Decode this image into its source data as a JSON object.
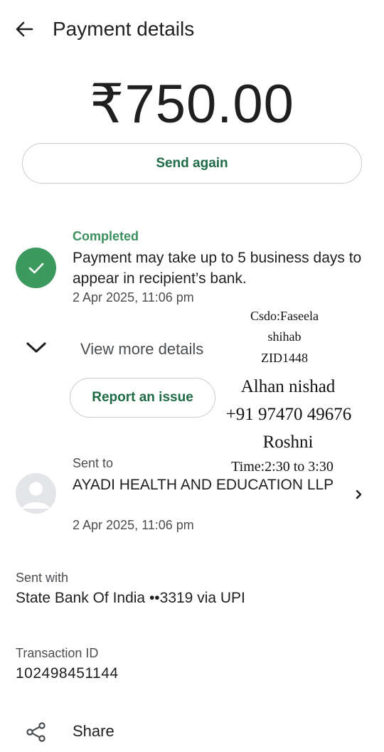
{
  "header": {
    "title": "Payment details",
    "back_icon": "arrow-left-icon"
  },
  "payment": {
    "amount": "₹750.00",
    "send_again_label": "Send again"
  },
  "status": {
    "label": "Completed",
    "message": "Payment may take up to 5 business days to appear in recipient’s bank.",
    "date": "2 Apr 2025, 11:06 pm",
    "icon": "check-circle-icon",
    "color": "#3d9a5e"
  },
  "details": {
    "view_more_label": "View more details",
    "report_label": "Report an issue"
  },
  "overlay_text": {
    "line1": "Csdo:Faseela",
    "line2": "shihab",
    "line3": "ZID1448",
    "line4": "Alhan nishad",
    "line5": "+91 97470 49676",
    "line6": "Roshni",
    "line7": "Time:2:30 to 3:30"
  },
  "recipient": {
    "label": "Sent to",
    "name": "AYADI HEALTH AND EDUCATION LLP",
    "date": "2 Apr 2025, 11:06 pm"
  },
  "sent_with": {
    "label": "Sent with",
    "value": "State Bank Of India ••3319 via UPI"
  },
  "transaction": {
    "label": "Transaction ID",
    "id": "102498451144"
  },
  "share": {
    "label": "Share",
    "icon": "share-icon"
  },
  "colors": {
    "accent_green": "#1e6b45",
    "status_green": "#3c8f5f",
    "border": "#c9cbce"
  }
}
